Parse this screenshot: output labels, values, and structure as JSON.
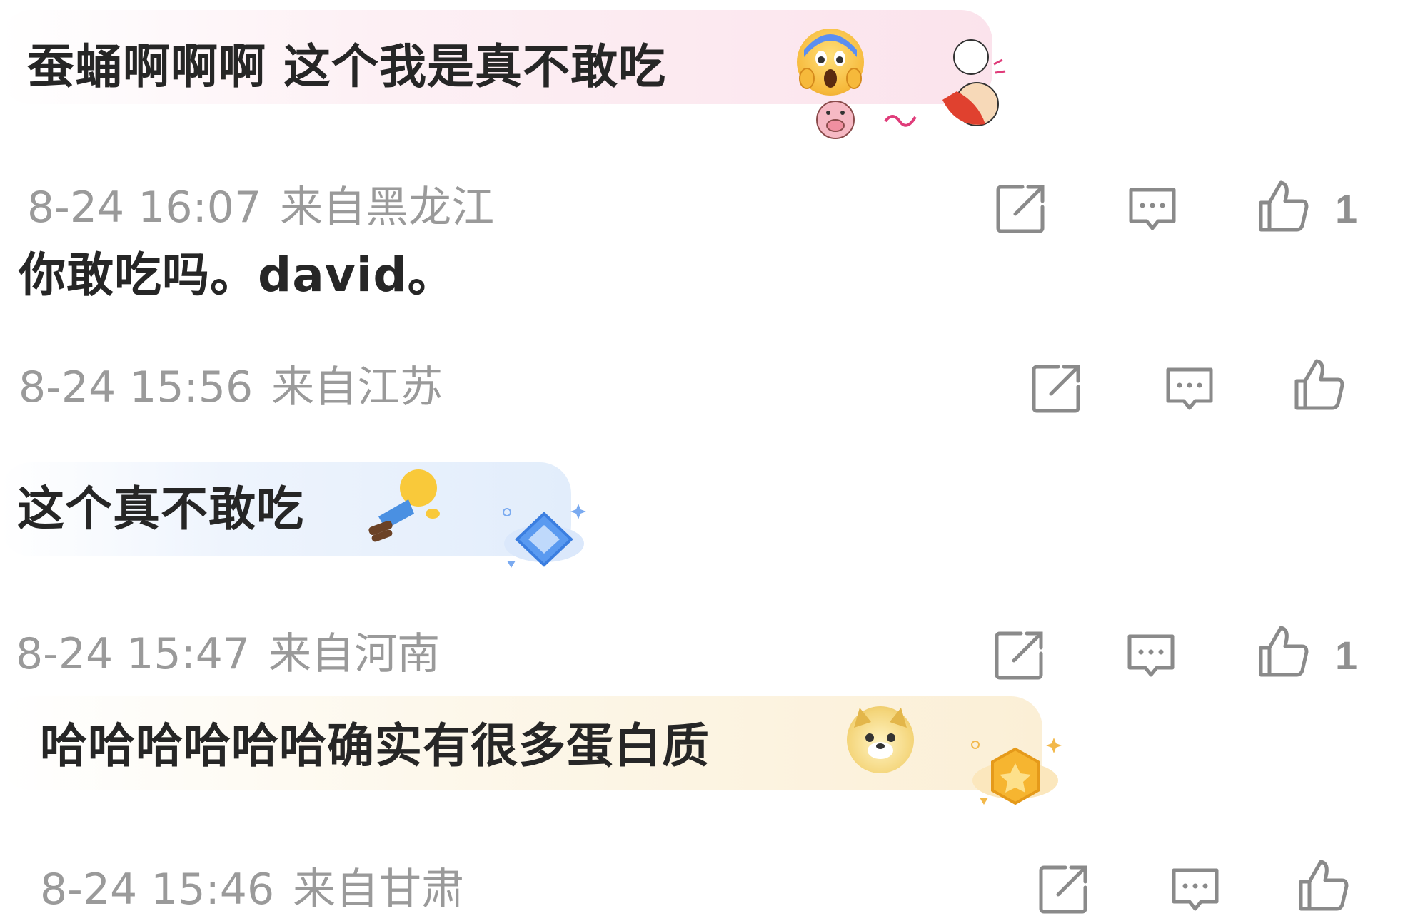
{
  "comments": [
    {
      "text": "蚕蛹啊啊啊 这个我是真不敢吃",
      "emoji": "scream-emoji",
      "bubble_theme": "pink",
      "meta_time": "8-24 16:07",
      "meta_location": "来自黑龙江",
      "likes": "1"
    },
    {
      "text": "你敢吃吗。david。",
      "meta_time": "8-24 15:56",
      "meta_location": "来自江苏",
      "likes": ""
    },
    {
      "text": "这个真不敢吃",
      "emoji": "faceplant-emoji",
      "bubble_theme": "blue",
      "meta_time": "8-24 15:47",
      "meta_location": "来自河南",
      "likes": "1"
    },
    {
      "text": "哈哈哈哈哈哈确实有很多蛋白质",
      "emoji": "doge-emoji",
      "bubble_theme": "gold",
      "meta_time": "8-24 15:46",
      "meta_location": "来自甘肃",
      "likes": ""
    }
  ],
  "icons": {
    "share": "share-icon",
    "reply": "comment-icon",
    "like": "thumbs-up-icon"
  },
  "colors": {
    "meta_text": "#9a9a9a",
    "comment_text": "#262626",
    "icon_stroke": "#8a8a8a",
    "pink_bubble": "#fbe3ec",
    "blue_bubble": "#e2edfb",
    "gold_bubble": "#fbefd6"
  }
}
